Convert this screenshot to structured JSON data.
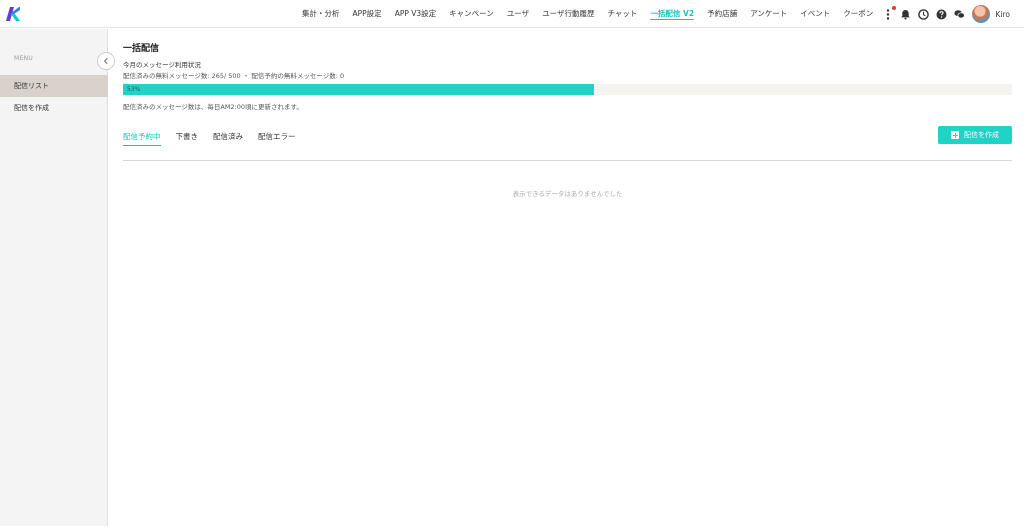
{
  "nav": {
    "items": [
      "集計・分析",
      "APP設定",
      "APP V3設定",
      "キャンペーン",
      "ユーザ",
      "ユーザ行動履歴",
      "チャット",
      "一括配信 V2",
      "予約店舗",
      "アンケート",
      "イベント",
      "クーポン"
    ],
    "active_index": 7
  },
  "user": {
    "name": "Kiro"
  },
  "sidebar": {
    "menu_label": "MENU",
    "items": [
      {
        "label": "配信リスト",
        "active": true
      },
      {
        "label": "配信を作成",
        "active": false
      }
    ]
  },
  "main": {
    "title": "一括配信",
    "usage": {
      "heading": "今月のメッセージ利用状況",
      "line": "配信済みの無料メッセージ数: 265/ 500 ・ 配信予約の無料メッセージ数: 0",
      "percent": 53,
      "percent_label": "53%",
      "note": "配信済みのメッセージ数は、毎日AM2:00頃に更新されます。"
    },
    "tabs": [
      {
        "label": "配信予約中",
        "active": true
      },
      {
        "label": "下書き",
        "active": false
      },
      {
        "label": "配信済み",
        "active": false
      },
      {
        "label": "配信エラー",
        "active": false
      }
    ],
    "create_button": "配信を作成",
    "empty_message": "表示できるデータはありませんでした"
  },
  "colors": {
    "accent": "#1fd3c6",
    "active_text": "#17c4b8",
    "sidebar_active": "#d9d2cb"
  },
  "icons": [
    "logo",
    "more-vertical-icon",
    "bell-icon",
    "clock-icon",
    "help-icon",
    "chat-icon",
    "chevron-left-icon",
    "plus-square-icon"
  ]
}
